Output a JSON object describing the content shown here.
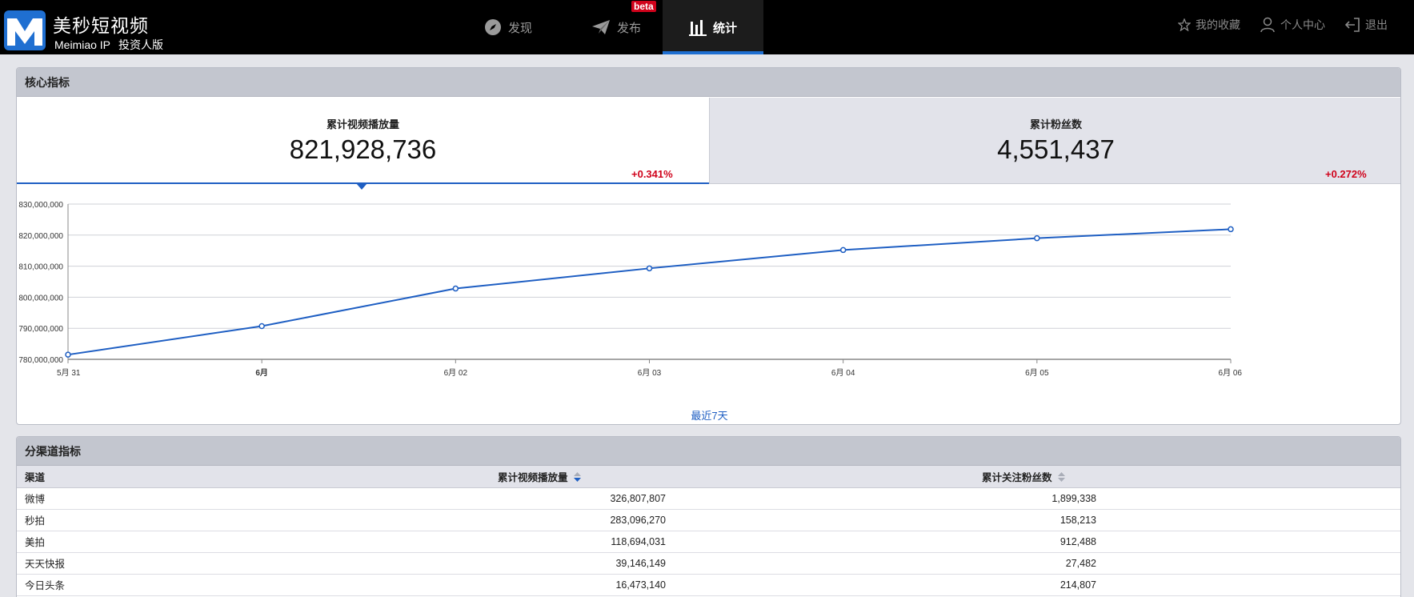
{
  "header": {
    "brand_title": "美秒短视频",
    "brand_sub_a": "Meimiao IP",
    "brand_sub_b": "投资人版",
    "nav": [
      {
        "label": "发现",
        "icon": "compass-icon"
      },
      {
        "label": "发布",
        "icon": "paper-plane-icon",
        "badge": "beta"
      },
      {
        "label": "统计",
        "icon": "bar-chart-icon",
        "active": true
      }
    ],
    "links": [
      {
        "label": "我的收藏",
        "icon": "star-icon"
      },
      {
        "label": "个人中心",
        "icon": "user-icon"
      },
      {
        "label": "退出",
        "icon": "sign-out-icon"
      }
    ],
    "accent_color": "#1f6fd1"
  },
  "core": {
    "title": "核心指标",
    "metrics": [
      {
        "label": "累计视频播放量",
        "value": "821,928,736",
        "change": "+0.341%",
        "selected": true
      },
      {
        "label": "累计粉丝数",
        "value": "4,551,437",
        "change": "+0.272%",
        "selected": false
      }
    ],
    "change_color": "#d0021b"
  },
  "chart_data": {
    "type": "line",
    "title": "",
    "xlabel": "最近7天",
    "ylabel": "",
    "categories": [
      "5月 31",
      "6月",
      "6月 02",
      "6月 03",
      "6月 04",
      "6月 05",
      "6月 06"
    ],
    "series": [
      {
        "values": [
          781500000,
          790700000,
          802800000,
          809300000,
          815200000,
          819000000,
          821900000
        ]
      }
    ],
    "ylim": [
      780000000,
      830000000
    ],
    "yticks": [
      "780,000,000",
      "790,000,000",
      "800,000,000",
      "810,000,000",
      "820,000,000",
      "830,000,000"
    ],
    "grid": true,
    "line_color": "#1f5fc3"
  },
  "channels": {
    "title": "分渠道指标",
    "columns": [
      "渠道",
      "累计视频播放量",
      "累计关注粉丝数"
    ],
    "rows": [
      [
        "微博",
        "326,807,807",
        "1,899,338"
      ],
      [
        "秒拍",
        "283,096,270",
        "158,213"
      ],
      [
        "美拍",
        "118,694,031",
        "912,488"
      ],
      [
        "天天快报",
        "39,146,149",
        "27,482"
      ],
      [
        "今日头条",
        "16,473,140",
        "214,807"
      ]
    ]
  }
}
